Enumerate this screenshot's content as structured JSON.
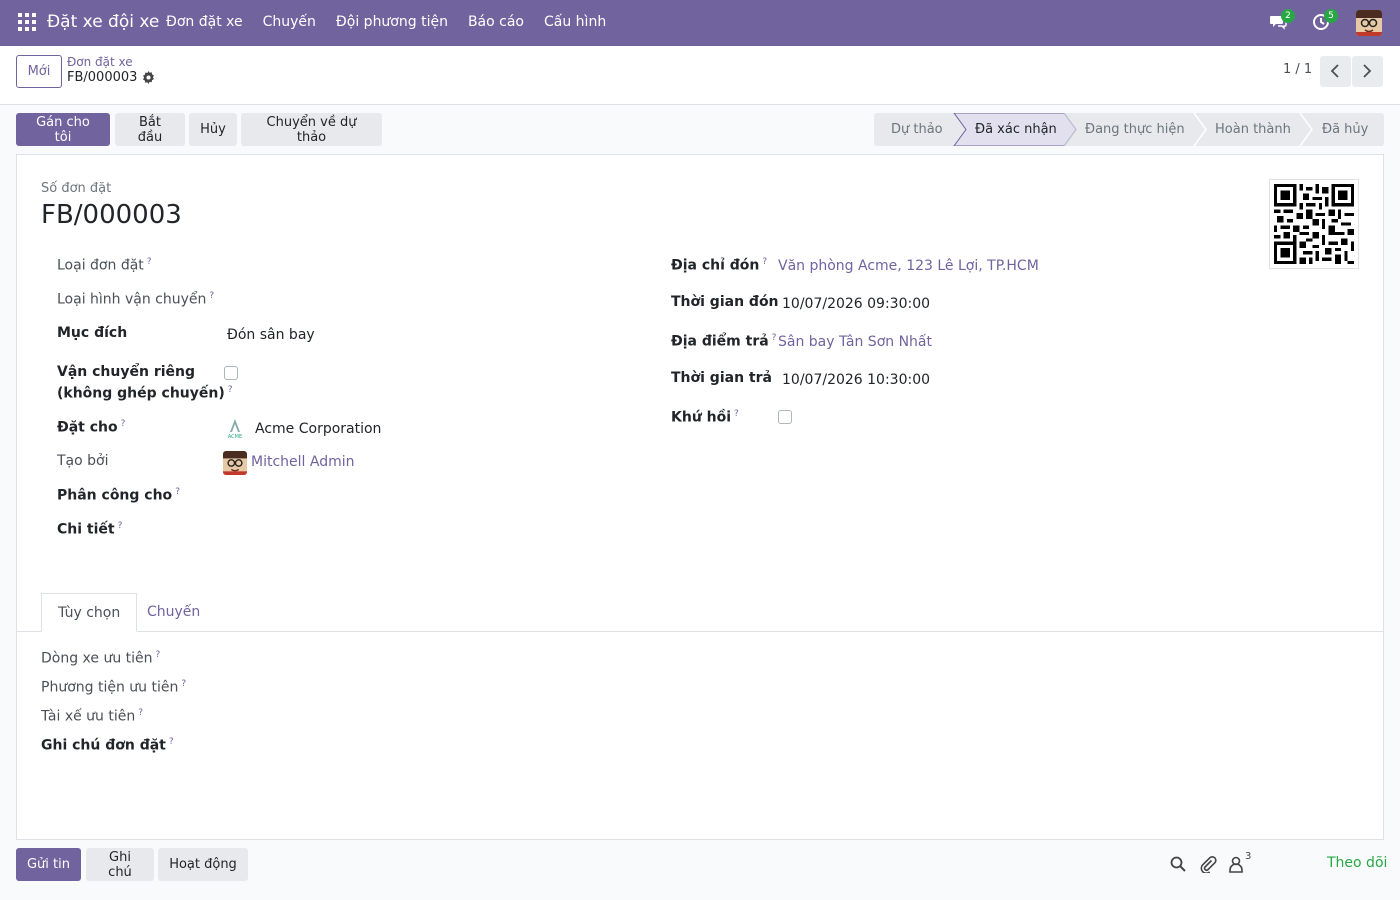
{
  "navbar": {
    "app_title": "Đặt xe đội xe",
    "menu": [
      "Đơn đặt xe",
      "Chuyến",
      "Đội phương tiện",
      "Báo cáo",
      "Cấu hình"
    ],
    "messages_count": "2",
    "activities_count": "5"
  },
  "control_panel": {
    "new_label": "Mới",
    "breadcrumb": "Đơn đặt xe",
    "record_name": "FB/000003",
    "pager": "1 / 1"
  },
  "actions": {
    "assign_me": "Gán cho tôi",
    "start": "Bắt đầu",
    "cancel": "Hủy",
    "to_draft": "Chuyển về dự thảo"
  },
  "statusbar": {
    "stages": [
      "Dự thảo",
      "Đã xác nhận",
      "Đang thực hiện",
      "Hoàn thành",
      "Đã hủy"
    ],
    "active_stage": "Đã xác nhận"
  },
  "form": {
    "number_label": "Số đơn đặt",
    "number": "FB/000003",
    "left_fields": {
      "booking_type": "Loại đơn đặt",
      "transport_type": "Loại hình vận chuyển",
      "purpose_label": "Mục đích",
      "purpose_value": "Đón sân bay",
      "private_line1": "Vận chuyển riêng",
      "private_line2": "(không ghép chuyến)",
      "booked_for_label": "Đặt cho",
      "booked_for_value": "Acme Corporation",
      "created_by_label": "Tạo bởi",
      "created_by_value": "Mitchell Admin",
      "assigned_to_label": "Phân công cho",
      "details_label": "Chi tiết"
    },
    "right_fields": {
      "pickup_address_label": "Địa chỉ đón",
      "pickup_address_value": "Văn phòng Acme, 123 Lê Lợi, TP.HCM",
      "pickup_time_label": "Thời gian đón",
      "pickup_time_value": "10/07/2026 09:30:00",
      "dropoff_label": "Địa điểm trả",
      "dropoff_value": "Sân bay Tân Sơn Nhất",
      "return_time_label": "Thời gian trả",
      "return_time_value": "10/07/2026 10:30:00",
      "round_trip_label": "Khứ hồi"
    },
    "acme_logo_text": "ACME"
  },
  "tabs": [
    "Tùy chọn",
    "Chuyến"
  ],
  "options_tab": {
    "preferred_model": "Dòng xe ưu tiên",
    "preferred_vehicle": "Phương tiện ưu tiên",
    "preferred_driver": "Tài xế ưu tiên",
    "booking_note": "Ghi chú đơn đặt"
  },
  "chatter": {
    "send_message": "Gửi tin",
    "log_note": "Ghi chú",
    "activity": "Hoạt động",
    "followers_count": "3",
    "follow": "Theo dõi"
  },
  "colors": {
    "brand": "#71639e",
    "success": "#28a745"
  }
}
